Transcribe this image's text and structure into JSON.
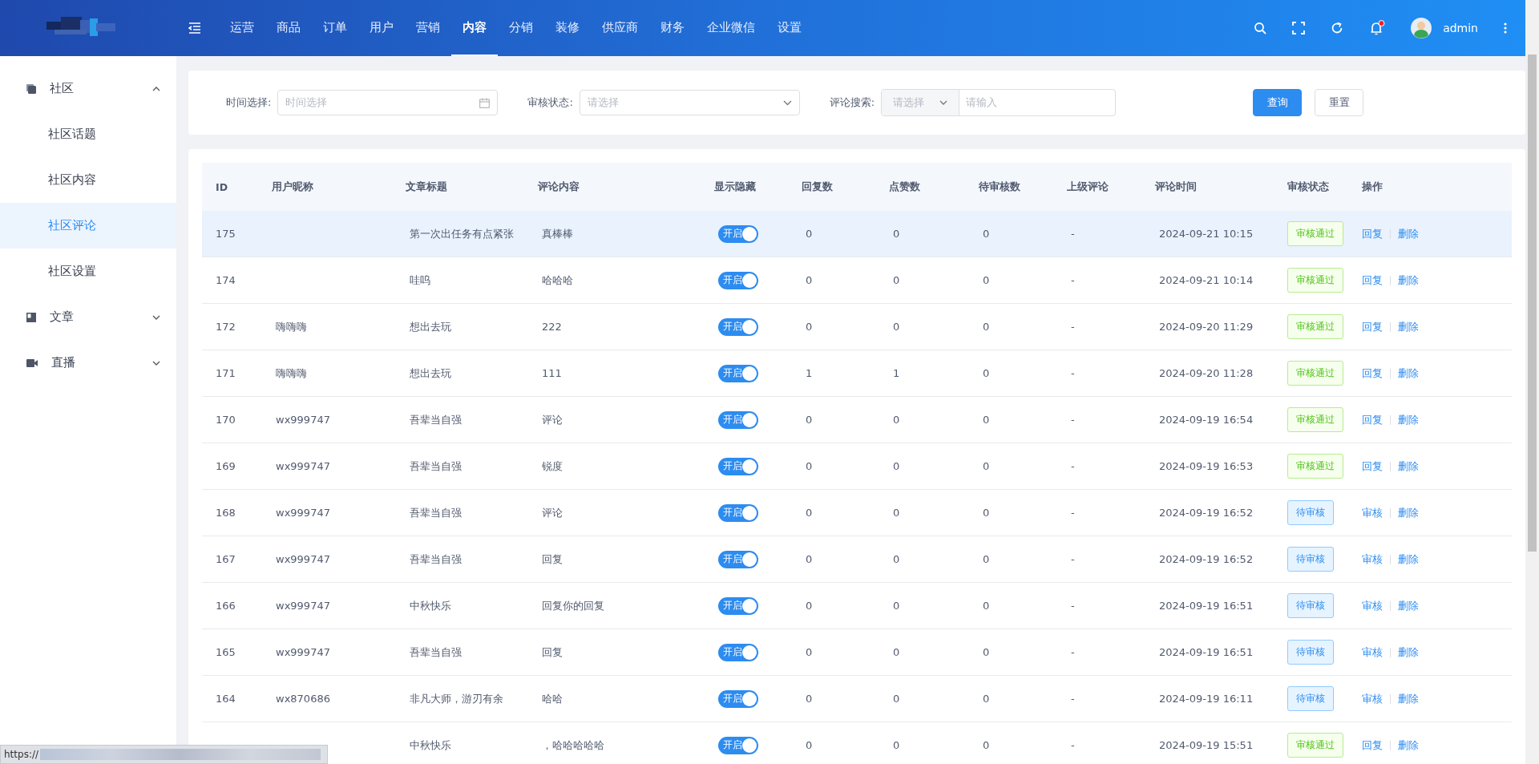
{
  "header": {
    "nav": [
      {
        "label": "运营",
        "selected": false
      },
      {
        "label": "商品",
        "selected": false
      },
      {
        "label": "订单",
        "selected": false
      },
      {
        "label": "用户",
        "selected": false
      },
      {
        "label": "营销",
        "selected": false
      },
      {
        "label": "内容",
        "selected": true
      },
      {
        "label": "分销",
        "selected": false
      },
      {
        "label": "装修",
        "selected": false
      },
      {
        "label": "供应商",
        "selected": false
      },
      {
        "label": "财务",
        "selected": false
      },
      {
        "label": "企业微信",
        "selected": false
      },
      {
        "label": "设置",
        "selected": false
      }
    ],
    "user": "admin",
    "has_notification": true
  },
  "sidebar": {
    "items": [
      {
        "label": "社区",
        "expanded": true,
        "children": [
          {
            "label": "社区话题",
            "selected": false
          },
          {
            "label": "社区内容",
            "selected": false
          },
          {
            "label": "社区评论",
            "selected": true
          },
          {
            "label": "社区设置",
            "selected": false
          }
        ]
      },
      {
        "label": "文章",
        "expanded": false
      },
      {
        "label": "直播",
        "expanded": false
      }
    ]
  },
  "filters": {
    "time": {
      "label": "时间选择:",
      "placeholder": "时间选择"
    },
    "status": {
      "label": "审核状态:",
      "placeholder": "请选择"
    },
    "search": {
      "label": "评论搜索:",
      "select_placeholder": "请选择",
      "placeholder": "请输入"
    },
    "buttons": [
      {
        "label": "查询",
        "kind": "primary"
      },
      {
        "label": "重置",
        "kind": "default"
      }
    ]
  },
  "table": {
    "columns": [
      "ID",
      "用户昵称",
      "文章标题",
      "评论内容",
      "显示隐藏",
      "回复数",
      "点赞数",
      "待审核数",
      "上级评论",
      "评论时间",
      "审核状态",
      "操作"
    ],
    "rows": [
      {
        "id": "175",
        "title": "第一次出任务有点紧张",
        "content": "真棒棒",
        "toggle": {
          "label": "开启",
          "on": true
        },
        "replies": "0",
        "likes": "0",
        "pending": "0",
        "parent": "-",
        "time": "2024-09-21 10:15",
        "status": {
          "label": "审核通过",
          "kind": "approved"
        },
        "actions": [
          "回复",
          "删除"
        ],
        "hovered": true
      },
      {
        "id": "174",
        "title": "哇呜",
        "content": "哈哈哈",
        "toggle": {
          "label": "开启",
          "on": true
        },
        "replies": "0",
        "likes": "0",
        "pending": "0",
        "parent": "-",
        "time": "2024-09-21 10:14",
        "status": {
          "label": "审核通过",
          "kind": "approved"
        },
        "actions": [
          "回复",
          "删除"
        ],
        "hovered": false
      },
      {
        "id": "172",
        "nickname": "嗨嗨嗨",
        "title": "想出去玩",
        "content": "222",
        "toggle": {
          "label": "开启",
          "on": true
        },
        "replies": "0",
        "likes": "0",
        "pending": "0",
        "parent": "-",
        "time": "2024-09-20 11:29",
        "status": {
          "label": "审核通过",
          "kind": "approved"
        },
        "actions": [
          "回复",
          "删除"
        ],
        "hovered": false
      },
      {
        "id": "171",
        "nickname": "嗨嗨嗨",
        "title": "想出去玩",
        "content": "111",
        "toggle": {
          "label": "开启",
          "on": true
        },
        "replies": "1",
        "likes": "1",
        "pending": "0",
        "parent": "-",
        "time": "2024-09-20 11:28",
        "status": {
          "label": "审核通过",
          "kind": "approved"
        },
        "actions": [
          "回复",
          "删除"
        ],
        "hovered": false
      },
      {
        "id": "170",
        "nickname": "wx999747",
        "title": "吾辈当自强",
        "content": "评论",
        "toggle": {
          "label": "开启",
          "on": true
        },
        "replies": "0",
        "likes": "0",
        "pending": "0",
        "parent": "-",
        "time": "2024-09-19 16:54",
        "status": {
          "label": "审核通过",
          "kind": "approved"
        },
        "actions": [
          "回复",
          "删除"
        ],
        "hovered": false
      },
      {
        "id": "169",
        "nickname": "wx999747",
        "title": "吾辈当自强",
        "content": "锐度",
        "toggle": {
          "label": "开启",
          "on": true
        },
        "replies": "0",
        "likes": "0",
        "pending": "0",
        "parent": "-",
        "time": "2024-09-19 16:53",
        "status": {
          "label": "审核通过",
          "kind": "approved"
        },
        "actions": [
          "回复",
          "删除"
        ],
        "hovered": false
      },
      {
        "id": "168",
        "nickname": "wx999747",
        "title": "吾辈当自强",
        "content": "评论",
        "toggle": {
          "label": "开启",
          "on": true
        },
        "replies": "0",
        "likes": "0",
        "pending": "0",
        "parent": "-",
        "time": "2024-09-19 16:52",
        "status": {
          "label": "待审核",
          "kind": "pending"
        },
        "actions": [
          "审核",
          "删除"
        ],
        "hovered": false
      },
      {
        "id": "167",
        "nickname": "wx999747",
        "title": "吾辈当自强",
        "content": "回复",
        "toggle": {
          "label": "开启",
          "on": true
        },
        "replies": "0",
        "likes": "0",
        "pending": "0",
        "parent": "-",
        "time": "2024-09-19 16:52",
        "status": {
          "label": "待审核",
          "kind": "pending"
        },
        "actions": [
          "审核",
          "删除"
        ],
        "hovered": false
      },
      {
        "id": "166",
        "nickname": "wx999747",
        "title": "中秋快乐",
        "content": "回复你的回复",
        "toggle": {
          "label": "开启",
          "on": true
        },
        "replies": "0",
        "likes": "0",
        "pending": "0",
        "parent": "-",
        "time": "2024-09-19 16:51",
        "status": {
          "label": "待审核",
          "kind": "pending"
        },
        "actions": [
          "审核",
          "删除"
        ],
        "hovered": false
      },
      {
        "id": "165",
        "nickname": "wx999747",
        "title": "吾辈当自强",
        "content": "回复",
        "toggle": {
          "label": "开启",
          "on": true
        },
        "replies": "0",
        "likes": "0",
        "pending": "0",
        "parent": "-",
        "time": "2024-09-19 16:51",
        "status": {
          "label": "待审核",
          "kind": "pending"
        },
        "actions": [
          "审核",
          "删除"
        ],
        "hovered": false
      },
      {
        "id": "164",
        "nickname": "wx870686",
        "title": "非凡大师，游刃有余",
        "content": "哈哈",
        "toggle": {
          "label": "开启",
          "on": true
        },
        "replies": "0",
        "likes": "0",
        "pending": "0",
        "parent": "-",
        "time": "2024-09-19 16:11",
        "status": {
          "label": "待审核",
          "kind": "pending"
        },
        "actions": [
          "审核",
          "删除"
        ],
        "hovered": false
      },
      {
        "title": "中秋快乐",
        "content": "，哈哈哈哈哈",
        "toggle": {
          "label": "开启",
          "on": true
        },
        "replies": "0",
        "likes": "0",
        "pending": "0",
        "parent": "-",
        "time": "2024-09-19 15:51",
        "status": {
          "label": "审核通过",
          "kind": "approved"
        },
        "actions": [
          "回复",
          "删除"
        ],
        "hovered": false
      }
    ]
  },
  "status_url": "https://"
}
